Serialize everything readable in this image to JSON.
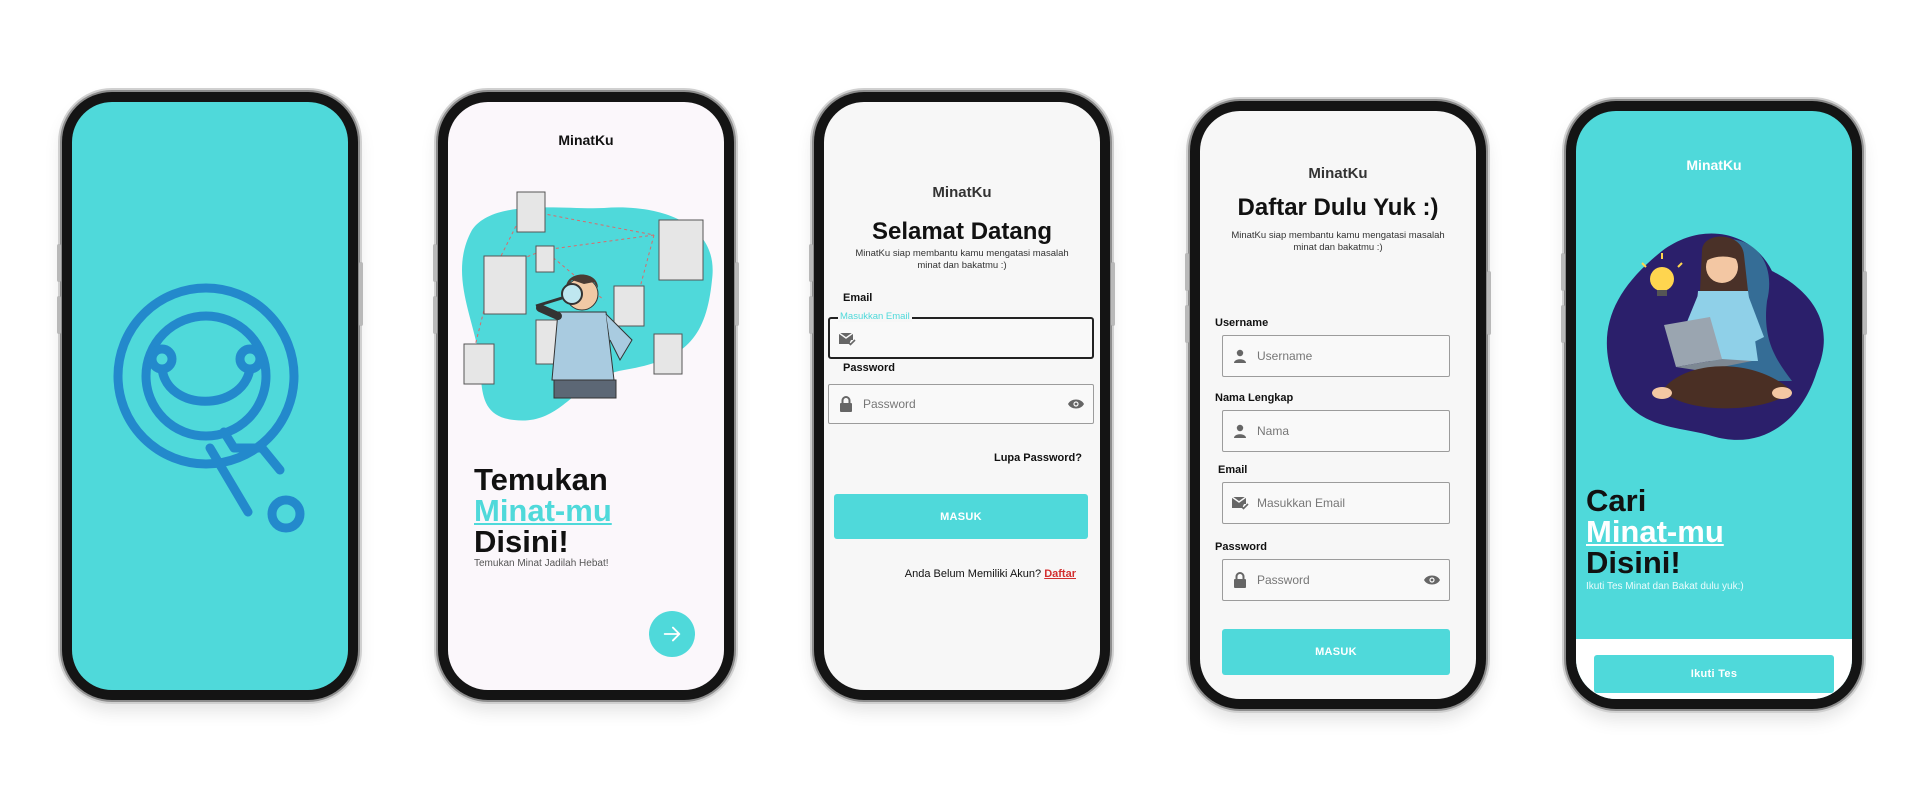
{
  "colors": {
    "accent": "#4fd9da",
    "logo_blue": "#2389cc",
    "link_red": "#d32f2f",
    "blob_navy": "#2b1f6b"
  },
  "screen1": {
    "logo_icon": "minatku-q-logo-icon"
  },
  "screen2": {
    "brand": "MinatKu",
    "title_line1": "Temukan",
    "title_line2": "Minat-mu",
    "title_line3": "Disini!",
    "subtitle": "Temukan Minat Jadilah Hebat!",
    "next_icon": "arrow-right-icon"
  },
  "screen3": {
    "brand": "MinatKu",
    "title": "Selamat Datang",
    "subtitle": "MinatKu siap membantu kamu mengatasi masalah minat dan bakatmu :)",
    "email_label": "Email",
    "email_floating_label": "Masukkan Email",
    "password_label": "Password",
    "password_placeholder": "Password",
    "forgot": "Lupa Password?",
    "submit": "MASUK",
    "no_account": "Anda Belum Memiliki Akun?",
    "register_link": "Daftar"
  },
  "screen4": {
    "brand": "MinatKu",
    "title": "Daftar Dulu Yuk :)",
    "subtitle": "MinatKu siap membantu kamu mengatasi masalah minat dan bakatmu :)",
    "username_label": "Username",
    "username_placeholder": "Username",
    "fullname_label": "Nama Lengkap",
    "fullname_placeholder": "Nama",
    "email_label": "Email",
    "email_placeholder": "Masukkan Email",
    "password_label": "Password",
    "password_placeholder": "Password",
    "submit": "MASUK"
  },
  "screen5": {
    "brand": "MinatKu",
    "title_line1": "Cari",
    "title_line2": "Minat-mu",
    "title_line3": "Disini!",
    "subtitle": "Ikuti Tes Minat dan Bakat dulu yuk:)",
    "cta": "Ikuti Tes"
  }
}
